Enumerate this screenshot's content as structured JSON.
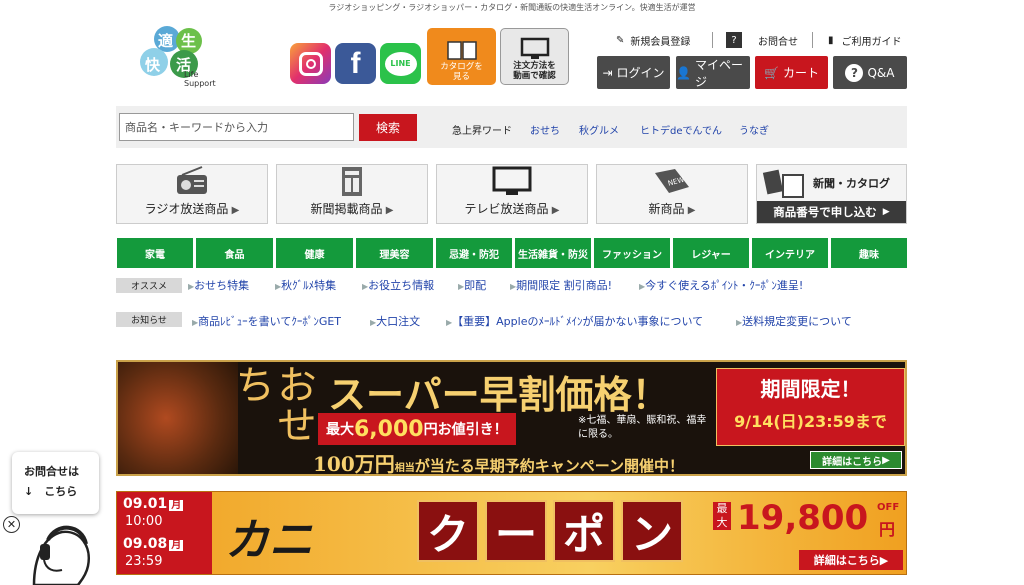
{
  "header": {
    "tagline": "ラジオショッピング・ラジオショッパー・カタログ・新聞通販の快適生活オンライン。快適生活が運営",
    "logo": {
      "chars": [
        "適",
        "生",
        "快",
        "活"
      ],
      "sub1": "Life",
      "sub2": "Support"
    },
    "social": {
      "line": "LINE"
    },
    "catalog_btn": "カタログを見る",
    "order_btn": "注文方法を動画で確認",
    "links": {
      "register": "新規会員登録",
      "contact": "お問合せ",
      "guide": "ご利用ガイド"
    },
    "buttons": {
      "login": "ログイン",
      "mypage": "マイページ",
      "cart": "カート",
      "qa": "Q&A"
    }
  },
  "search": {
    "placeholder": "商品名・キーワードから入力",
    "button": "検索",
    "trend_label": "急上昇ワード",
    "trends": [
      "おせち",
      "秋グルメ",
      "ヒトデdeでんでん",
      "うなぎ"
    ]
  },
  "categories": [
    "ラジオ放送商品",
    "新聞掲載商品",
    "テレビ放送商品",
    "新商品"
  ],
  "catalog_box": {
    "top": "新聞・カタログ",
    "bottom": "商品番号で申し込む"
  },
  "nav": [
    "家電",
    "食品",
    "健康",
    "理美容",
    "忌避・防犯",
    "生活雑貨・防災",
    "ファッション",
    "レジャー",
    "インテリア",
    "趣味"
  ],
  "osusume": {
    "tag": "オススメ",
    "links": [
      "おせち特集",
      "秋ｸﾞﾙﾒ特集",
      "お役立ち情報",
      "即配",
      "期間限定 割引商品!",
      "今すぐ使えるﾎﾟｲﾝﾄ・ｸｰﾎﾟﾝ進呈!"
    ]
  },
  "notice": {
    "tag": "お知らせ",
    "links": [
      "商品ﾚﾋﾞｭｰを書いてｸｰﾎﾟﾝGET",
      "大口注文",
      "【重要】Appleのﾒｰﾙﾄﾞﾒｲﾝが届かない事象について",
      "送料規定変更について"
    ]
  },
  "banner1": {
    "osechi": "おせち",
    "headline": "スーパー早割価格！",
    "discount_pre": "最大",
    "discount_num": "6,000",
    "discount_post": "円お値引き！",
    "note": "※七福、華扇、賑和祝、福幸に限る。",
    "limited": "期間限定！",
    "deadline": "9/14(日)23:59まで",
    "campaign_num": "100万円",
    "campaign_mid": "相当",
    "campaign_rest": "が当たる早期予約キャンペーン開催中！",
    "detail": "詳細はこちら"
  },
  "banner2": {
    "date1": "09.01",
    "day1": "月",
    "time1": "10:00",
    "date2": "09.08",
    "day2": "月",
    "time2": "23:59",
    "kani": "カニ",
    "coupon": [
      "ク",
      "ー",
      "ポ",
      "ン"
    ],
    "max": "最大",
    "amount": "19,800",
    "off": "OFF",
    "yen": "円",
    "detail": "詳細はこちら"
  },
  "float_contact": {
    "line1": "お問合せは",
    "line2": "↓　こちら"
  },
  "colors": {
    "green": "#149a3c",
    "red": "#c8161e",
    "dark": "#4a4a4a"
  }
}
